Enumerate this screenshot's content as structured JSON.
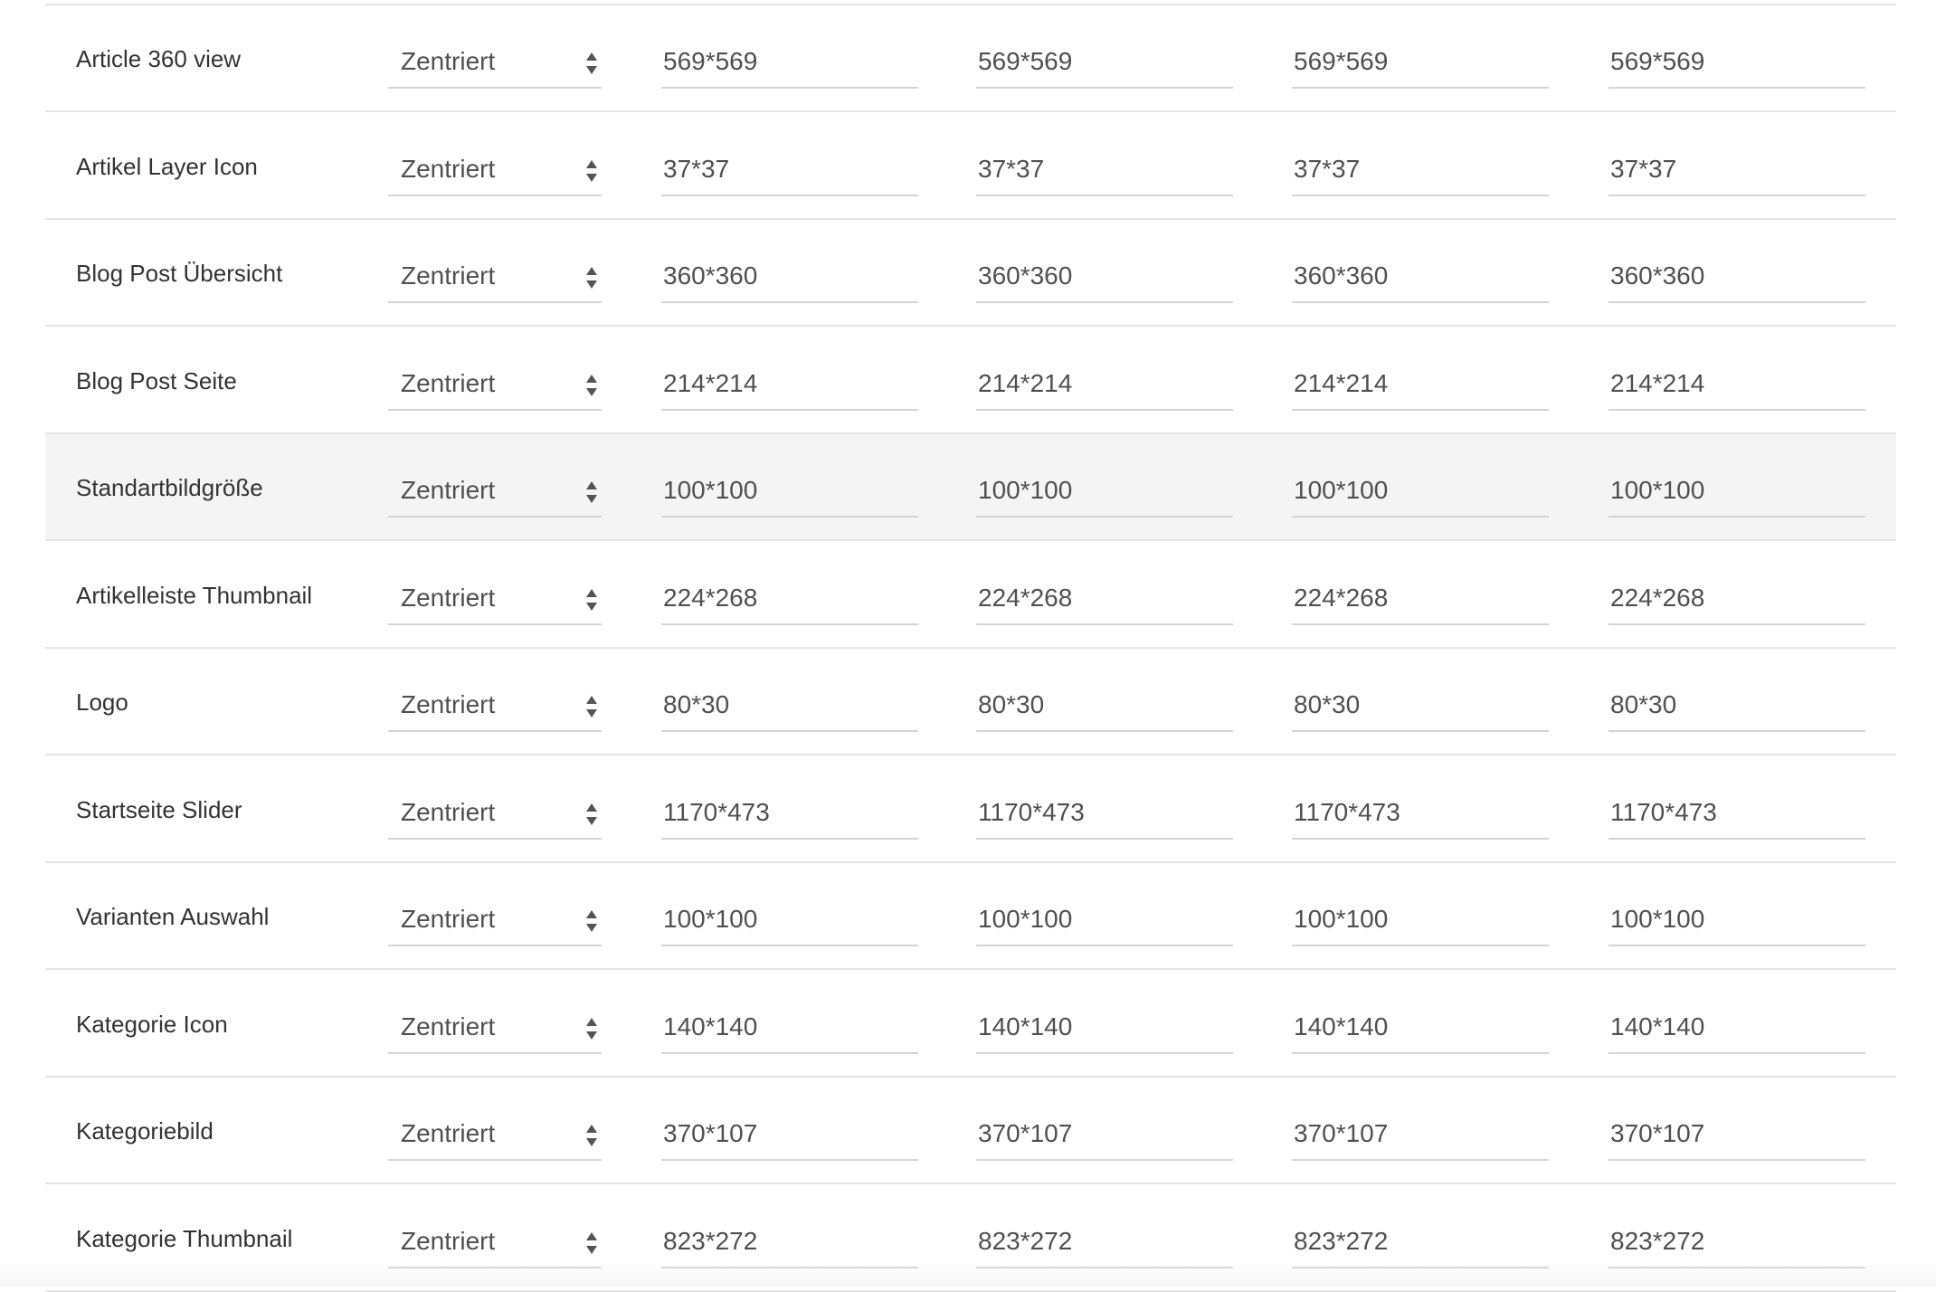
{
  "select_option": "Zentriert",
  "rows": [
    {
      "label": "Article 360 view",
      "values": [
        "569*569",
        "569*569",
        "569*569",
        "569*569"
      ]
    },
    {
      "label": "Artikel Layer Icon",
      "values": [
        "37*37",
        "37*37",
        "37*37",
        "37*37"
      ]
    },
    {
      "label": "Blog Post Übersicht",
      "values": [
        "360*360",
        "360*360",
        "360*360",
        "360*360"
      ]
    },
    {
      "label": "Blog Post Seite",
      "values": [
        "214*214",
        "214*214",
        "214*214",
        "214*214"
      ]
    },
    {
      "label": "Standartbildgröße",
      "values": [
        "100*100",
        "100*100",
        "100*100",
        "100*100"
      ],
      "highlighted": true
    },
    {
      "label": "Artikelleiste Thumbnail",
      "values": [
        "224*268",
        "224*268",
        "224*268",
        "224*268"
      ]
    },
    {
      "label": "Logo",
      "values": [
        "80*30",
        "80*30",
        "80*30",
        "80*30"
      ]
    },
    {
      "label": "Startseite Slider",
      "values": [
        "1170*473",
        "1170*473",
        "1170*473",
        "1170*473"
      ]
    },
    {
      "label": "Varianten Auswahl",
      "values": [
        "100*100",
        "100*100",
        "100*100",
        "100*100"
      ]
    },
    {
      "label": "Kategorie Icon",
      "values": [
        "140*140",
        "140*140",
        "140*140",
        "140*140"
      ]
    },
    {
      "label": "Kategoriebild",
      "values": [
        "370*107",
        "370*107",
        "370*107",
        "370*107"
      ]
    },
    {
      "label": "Kategorie Thumbnail",
      "values": [
        "823*272",
        "823*272",
        "823*272",
        "823*272"
      ]
    }
  ],
  "colors": {
    "row_border": "#e4e4e4",
    "row_highlight": "#f4f4f4",
    "input_underline": "#d4d4d4",
    "text": "#333333",
    "arrow": "#555555"
  },
  "icons": {
    "select_arrow": "sort-arrows-icon"
  }
}
